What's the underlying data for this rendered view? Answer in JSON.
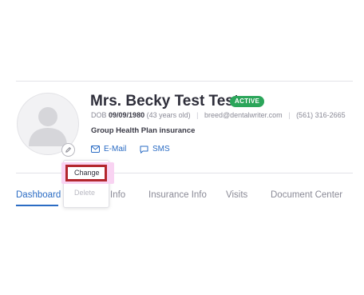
{
  "patient": {
    "name": "Mrs. Becky Test Test",
    "status": "ACTIVE",
    "dob_label": "DOB",
    "dob": "09/09/1980",
    "age": "(43 years old)",
    "email": "breed@dentalwriter.com",
    "phone": "(561) 316-2665",
    "insurance": "Group Health Plan insurance"
  },
  "contact": {
    "email_label": "E-Mail",
    "sms_label": "SMS"
  },
  "tabs": [
    {
      "label": "Dashboard",
      "active": true
    },
    {
      "label": "Info",
      "active": false
    },
    {
      "label": "Insurance Info",
      "active": false
    },
    {
      "label": "Visits",
      "active": false
    },
    {
      "label": "Document Center",
      "active": false
    }
  ],
  "avatar_menu": {
    "change_label": "Change",
    "delete_label": "Delete"
  },
  "colors": {
    "accent": "#2b6cc4",
    "status_active": "#2ba55a",
    "highlight_border": "#b3262d"
  },
  "icons": {
    "avatar": "user-placeholder-icon",
    "edit": "pencil-icon",
    "email": "envelope-icon",
    "sms": "chat-bubble-icon"
  }
}
